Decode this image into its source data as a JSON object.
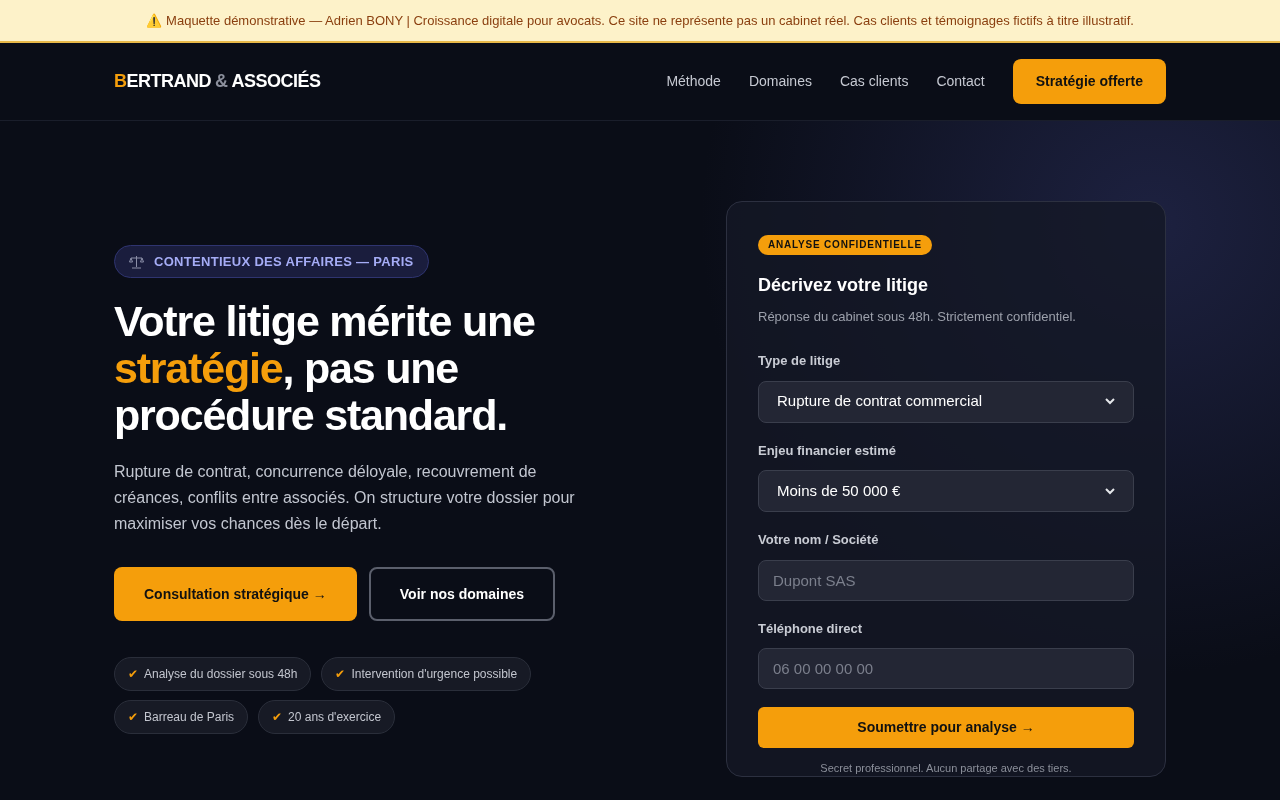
{
  "banner": {
    "icon": "⚠️",
    "text": "Maquette démonstrative — Adrien BONY | Croissance digitale pour avocats. Ce site ne représente pas un cabinet réel. Cas clients et témoignages fictifs à titre illustratif."
  },
  "logo": {
    "initial": "B",
    "rest": "ERTRAND",
    "amp": "&",
    "second": "ASSOCIÉS"
  },
  "nav": {
    "links": [
      "Méthode",
      "Domaines",
      "Cas clients",
      "Contact"
    ],
    "cta": "Stratégie offerte"
  },
  "hero": {
    "tag": "CONTENTIEUX DES AFFAIRES — PARIS",
    "headline": {
      "before": "Votre litige mérite une ",
      "highlight": "stratégie",
      "after": ", pas une procédure standard."
    },
    "text": "Rupture de contrat, concurrence déloyale, recouvrement de créances, conflits entre associés. On structure votre dossier pour maximiser vos chances dès le départ.",
    "buttons": [
      {
        "label": "Consultation stratégique →",
        "kind": "primary"
      },
      {
        "label": "Voir nos domaines",
        "kind": "outline"
      }
    ],
    "check": "✔",
    "badges": [
      "Analyse du dossier sous 48h",
      "Intervention d'urgence possible",
      "Barreau de Paris",
      "20 ans d'exercice"
    ]
  },
  "form": {
    "badge": "ANALYSE CONFIDENTIELLE",
    "title": "Décrivez votre litige",
    "subtitle": "Réponse du cabinet sous 48h. Strictement confidentiel.",
    "fields": [
      {
        "label": "Type de litige",
        "kind": "select",
        "value": "Rupture de contrat commercial"
      },
      {
        "label": "Enjeu financier estimé",
        "kind": "select",
        "value": "Moins de 50 000 €"
      },
      {
        "label": "Votre nom / Société",
        "kind": "input",
        "placeholder": "Dupont SAS"
      },
      {
        "label": "Téléphone direct",
        "kind": "input",
        "placeholder": "06 00 00 00 00"
      }
    ],
    "submit": "Soumettre pour analyse →",
    "note": "Secret professionnel. Aucun partage avec des tiers."
  }
}
